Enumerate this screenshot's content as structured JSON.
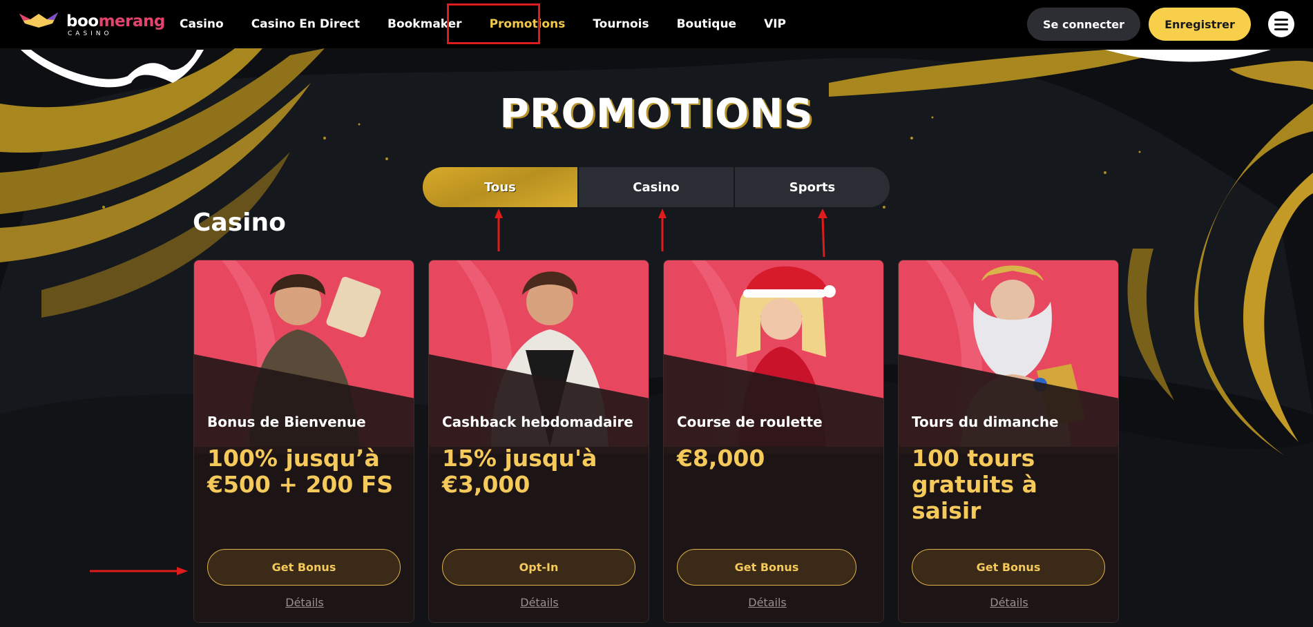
{
  "brand": {
    "name_part1": "boo",
    "name_part2": "merang",
    "subtitle": "CASINO"
  },
  "nav": {
    "items": [
      {
        "label": "Casino"
      },
      {
        "label": "Casino En Direct"
      },
      {
        "label": "Bookmaker"
      },
      {
        "label": "Promotions",
        "active": true
      },
      {
        "label": "Tournois"
      },
      {
        "label": "Boutique"
      },
      {
        "label": "VIP"
      }
    ],
    "login_label": "Se connecter",
    "register_label": "Enregistrer",
    "menu_icon": "hamburger-icon"
  },
  "page": {
    "title": "PROMOTIONS",
    "section_title": "Casino"
  },
  "tabs": [
    {
      "label": "Tous",
      "active": true
    },
    {
      "label": "Casino"
    },
    {
      "label": "Sports"
    }
  ],
  "cards": [
    {
      "name": "Bonus de Bienvenue",
      "value": "100% jusqu’à €500 + 200 FS",
      "button": "Get Bonus",
      "link": "Détails"
    },
    {
      "name": "Cashback hebdomadaire",
      "value": "15% jusqu'à €3,000",
      "button": "Opt-In",
      "link": "Détails"
    },
    {
      "name": "Course de roulette",
      "value": "€8,000",
      "button": "Get Bonus",
      "link": "Détails"
    },
    {
      "name": "Tours du dimanche",
      "value": "100 tours gratuits à saisir",
      "button": "Get Bonus",
      "link": "Détails"
    }
  ],
  "colors": {
    "accent_gold": "#f5c95a",
    "register_yellow": "#f7cf4a",
    "annotation_red": "#e01b1b",
    "card_red": "#e8485f"
  }
}
